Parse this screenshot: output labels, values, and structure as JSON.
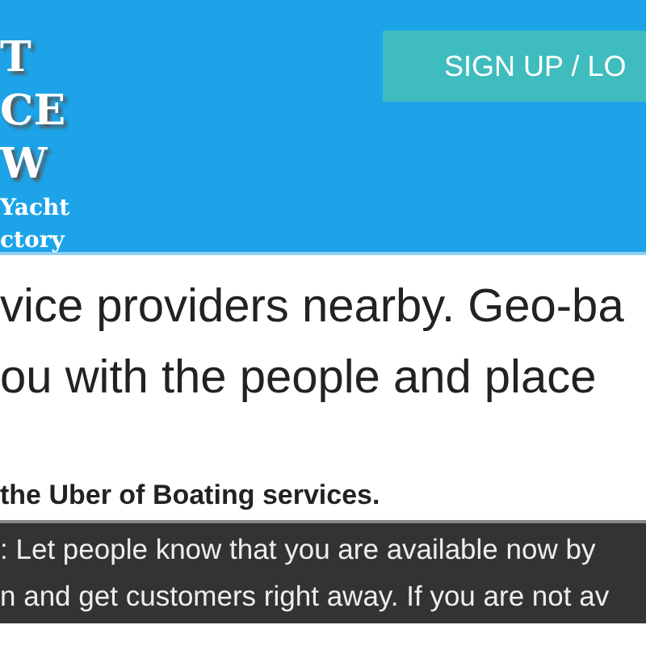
{
  "header": {
    "logo_lines": [
      "T",
      "CE",
      "W"
    ],
    "logo_tagline": [
      "Yacht",
      "ctory"
    ],
    "signup_button": "SIGN UP / LO"
  },
  "intro_lines": [
    "vice providers nearby. Geo-ba",
    "ou with the people and place"
  ],
  "tagline": "the Uber of Boating services.",
  "notice_lines": [
    ": Let people know that you are available now by",
    "n and get customers right away. If you are not av"
  ]
}
